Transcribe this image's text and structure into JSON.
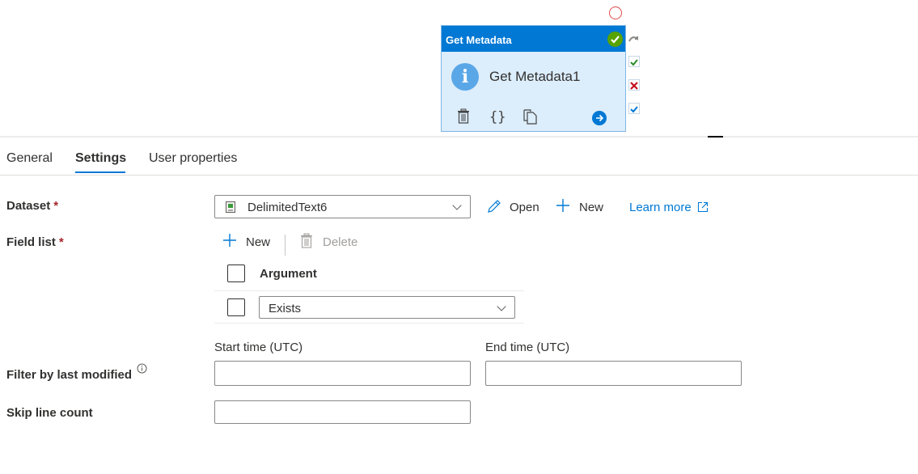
{
  "activity": {
    "type_label": "Get Metadata",
    "name": "Get Metadata1",
    "status": "succeeded",
    "tools": [
      "delete-icon",
      "code-icon",
      "copy-icon",
      "go-arrow-icon"
    ],
    "ports": [
      "skip-icon",
      "success-icon",
      "failure-icon",
      "completion-icon"
    ]
  },
  "tabs": [
    {
      "label": "General",
      "active": false
    },
    {
      "label": "Settings",
      "active": true
    },
    {
      "label": "User properties",
      "active": false
    }
  ],
  "form": {
    "dataset": {
      "label": "Dataset",
      "required_mark": "*",
      "selected": "DelimitedText6",
      "open_label": "Open",
      "new_label": "New",
      "learn_more_label": "Learn more"
    },
    "field_list": {
      "label": "Field list",
      "required_mark": "*",
      "new_label": "New",
      "delete_label": "Delete",
      "column_header": "Argument",
      "rows": [
        {
          "value": "Exists",
          "checked": false
        }
      ]
    },
    "filter": {
      "label": "Filter by last modified",
      "start_label": "Start time (UTC)",
      "start_value": "",
      "end_label": "End time (UTC)",
      "end_value": ""
    },
    "skip": {
      "label": "Skip line count",
      "value": ""
    }
  },
  "colors": {
    "accent": "#0078d4",
    "success": "#57a300",
    "failure": "#c50f1f",
    "required": "#a4262c"
  }
}
